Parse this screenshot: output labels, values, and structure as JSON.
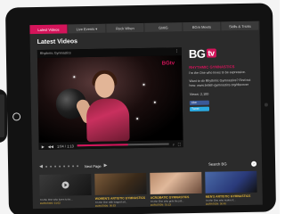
{
  "nav": {
    "items": [
      {
        "label": "Latest Videos",
        "active": true
      },
      {
        "label": "Live Events",
        "has_dropdown": true
      },
      {
        "label": "Rock When"
      },
      {
        "label": "GMIG"
      },
      {
        "label": "BGm Meets"
      },
      {
        "label": "Skills & Tricks"
      }
    ]
  },
  "main": {
    "title": "Latest Videos"
  },
  "player": {
    "header_text": "Rhythmic Gymnastics",
    "share_icon": "share-icon",
    "watermark_prefix": "BG",
    "watermark_suffix": "tv",
    "time": "1:04 / 1:13",
    "progress": 0.55
  },
  "info": {
    "logo_text": "BG",
    "logo_tv": "tv",
    "title": "RHYTHMIC GYMNASTICS",
    "desc": "I'm the One who loves to be expressive.",
    "desc2": "Want to do Rhythmic Gymnastics? Find out how: www.british-gymnastics.org/discover",
    "views": "Views: 2,100",
    "like_label": "Like",
    "tweet_label": "Tweet"
  },
  "pager": {
    "next_label": "Next Page"
  },
  "search": {
    "label": "Search BG",
    "icon": "arrow-right-icon"
  },
  "thumbs": [
    {
      "title": "",
      "desc": "I'm the One who loves to be...",
      "duration": "DURATION: 01:02"
    },
    {
      "title": "WOMEN'S ARTISTIC GYMNASTICS",
      "desc": "I'm the One with longest art...",
      "duration": "DURATION: 00:53"
    },
    {
      "title": "ACROBATIC GYMNASTICS",
      "desc": "I'm the One who gets the job...",
      "duration": "DURATION: 01:13"
    },
    {
      "title": "MEN'S ARTISTIC GYMNASTICS",
      "desc": "I'm the One who makes it...",
      "duration": "DURATION: 00:49"
    }
  ],
  "colors": {
    "accent": "#d4145a",
    "thumb_title": "#e8b93c",
    "background": "#2b2b2b"
  }
}
